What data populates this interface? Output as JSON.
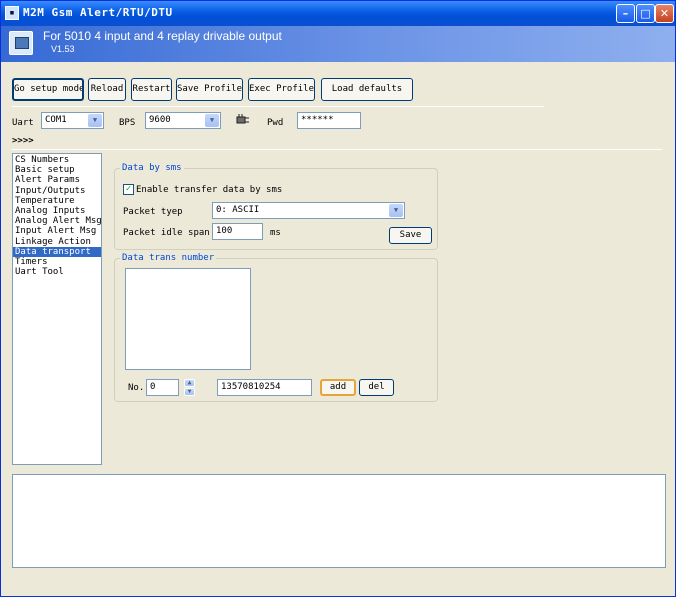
{
  "window": {
    "title": "M2M Gsm Alert/RTU/DTU",
    "minimize_glyph": "–",
    "maximize_glyph": "□",
    "close_glyph": "✕"
  },
  "banner": {
    "title": "For 5010 4 input and 4 replay drivable output",
    "version": "V1.53"
  },
  "toolbar": {
    "setup_mode": "Go setup mode",
    "reload": "Reload",
    "restart": "Restart",
    "save_profile": "Save Profile",
    "exec_profile": "Exec Profile",
    "load_defaults": "Load defaults"
  },
  "connection": {
    "uart_label": "Uart",
    "uart_value": "COM1",
    "bps_label": "BPS",
    "bps_value": "9600",
    "pwd_label": "Pwd",
    "pwd_value": "******",
    "connect_icon": "connection-plug-icon"
  },
  "breadcrumb": ">>>>",
  "sidebar": {
    "items": [
      {
        "label": "CS Numbers"
      },
      {
        "label": "Basic setup"
      },
      {
        "label": "Alert Params"
      },
      {
        "label": "Input/Outputs"
      },
      {
        "label": "Temperature"
      },
      {
        "label": "Analog Inputs"
      },
      {
        "label": "Analog Alert Msg"
      },
      {
        "label": "Input Alert Msg"
      },
      {
        "label": "Linkage Action"
      },
      {
        "label": "Data transport",
        "selected": true
      },
      {
        "label": "Timers"
      },
      {
        "label": "Uart Tool"
      }
    ]
  },
  "data_by_sms": {
    "group_title": "Data by sms",
    "enable_label": "Enable transfer data by sms",
    "enable_checked": true,
    "packet_type_label": "Packet tyep",
    "packet_type_value": "0: ASCII",
    "idle_span_label": "Packet idle span",
    "idle_span_value": "100",
    "idle_span_unit": "ms",
    "save_label": "Save"
  },
  "data_trans_number": {
    "group_title": "Data trans number",
    "no_label": "No.",
    "no_value": "0",
    "phone_value": "13570810254",
    "add_label": "add",
    "del_label": "del"
  },
  "colors": {
    "titlebar": "#0a5fe5",
    "window_bg": "#ece9d8",
    "group_title": "#0046d5",
    "selection": "#316ac5"
  }
}
